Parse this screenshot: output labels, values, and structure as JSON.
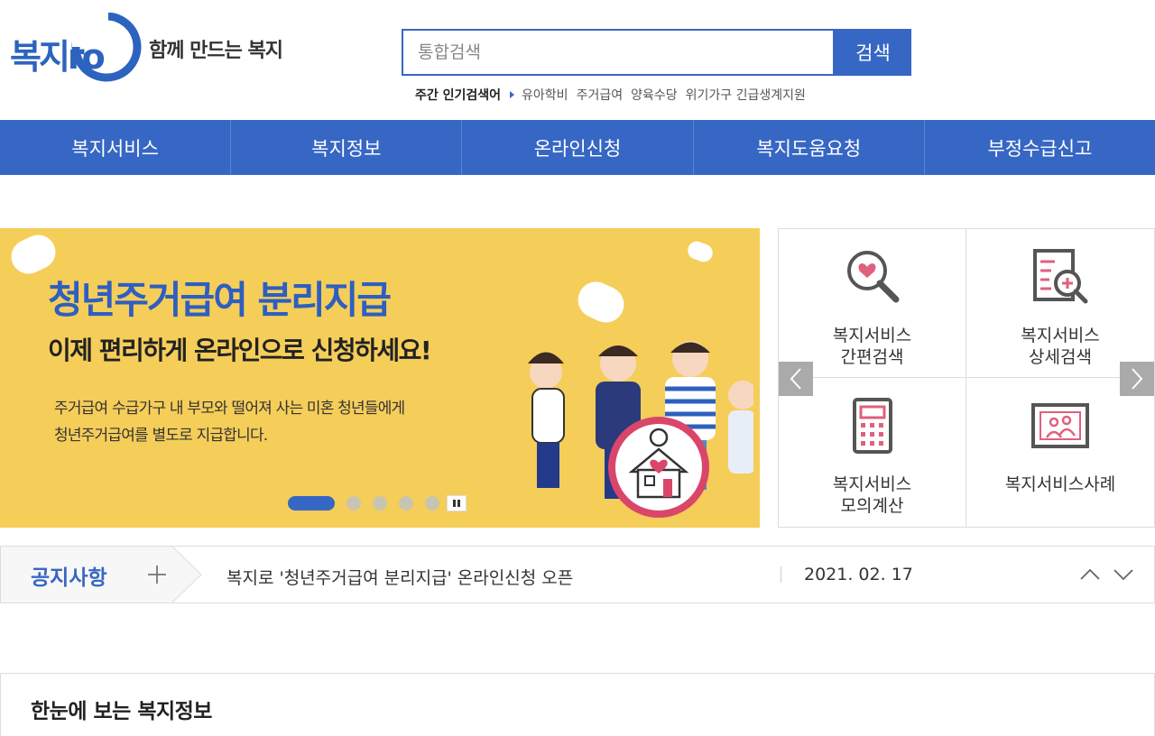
{
  "header": {
    "logo_text": "복지ro",
    "tagline": "함께 만드는 복지",
    "search": {
      "placeholder": "통합검색",
      "value": "",
      "button_label": "검색"
    },
    "popular": {
      "label": "주간 인기검색어",
      "keywords": [
        "유아학비",
        "주거급여",
        "양육수당",
        "위기가구 긴급생계지원"
      ]
    }
  },
  "nav": {
    "items": [
      "복지서비스",
      "복지정보",
      "온라인신청",
      "복지도움요청",
      "부정수급신고"
    ]
  },
  "banner": {
    "title": "청년주거급여 분리지급",
    "subtitle": "이제 편리하게 온라인으로 신청하세요!",
    "description_line1": "주거급여 수급가구 내 부모와 떨어져 사는 미혼 청년들에게",
    "description_line2": "청년주거급여를 별도로 지급합니다.",
    "slide_count": 5,
    "active_slide": 1
  },
  "quick_menu": {
    "items": [
      {
        "line1": "복지서비스",
        "line2": "간편검색",
        "icon": "magnifier-heart-icon"
      },
      {
        "line1": "복지서비스",
        "line2": "상세검색",
        "icon": "document-search-icon"
      },
      {
        "line1": "복지서비스",
        "line2": "모의계산",
        "icon": "calculator-icon"
      },
      {
        "line1": "복지서비스사례",
        "line2": "",
        "icon": "picture-people-icon"
      }
    ]
  },
  "notice": {
    "label": "공지사항",
    "text": "복지로 '청년주거급여 분리지급' 온라인신청 오픈",
    "date": "2021. 02. 17"
  },
  "section": {
    "title": "한눈에 보는 복지정보"
  },
  "colors": {
    "primary": "#3767c4",
    "banner_bg": "#f5cd59",
    "icon_pink": "#e0607e"
  }
}
